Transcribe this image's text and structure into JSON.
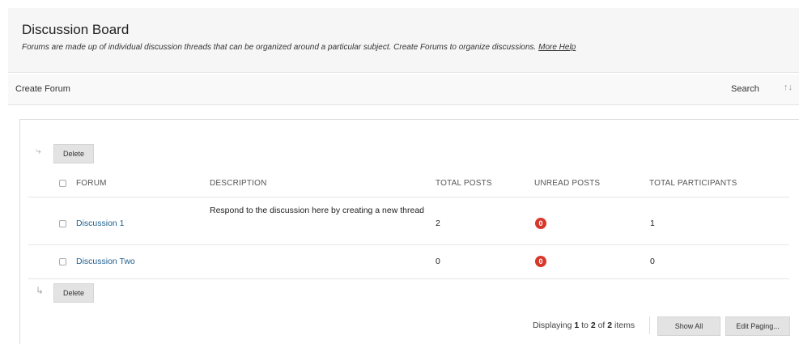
{
  "header": {
    "title": "Discussion Board",
    "subtitle": "Forums are made up of individual discussion threads that can be organized around a particular subject. Create Forums to organize discussions.",
    "help_link": "More Help"
  },
  "actionbar": {
    "create_forum": "Create Forum",
    "search": "Search",
    "sort_icon": "sort-arrows-icon"
  },
  "list": {
    "delete_label": "Delete",
    "columns": [
      "FORUM",
      "DESCRIPTION",
      "TOTAL POSTS",
      "UNREAD POSTS",
      "TOTAL PARTICIPANTS"
    ],
    "rows": [
      {
        "forum": "Discussion 1",
        "description": "Respond to the discussion here by creating a new thread",
        "total_posts": "2",
        "unread_posts": "0",
        "total_participants": "1"
      },
      {
        "forum": "Discussion Two",
        "description": "",
        "total_posts": "0",
        "unread_posts": "0",
        "total_participants": "0"
      }
    ]
  },
  "paging": {
    "prefix": "Displaying",
    "from": "1",
    "to_word": "to",
    "to": "2",
    "of_word": "of",
    "total": "2",
    "suffix": "items",
    "show_all": "Show All",
    "edit_paging": "Edit Paging..."
  },
  "colors": {
    "link": "#1f5f8f",
    "badge": "#d8372b",
    "button_bg": "#e3e3e3",
    "header_bg": "#f6f6f6"
  }
}
